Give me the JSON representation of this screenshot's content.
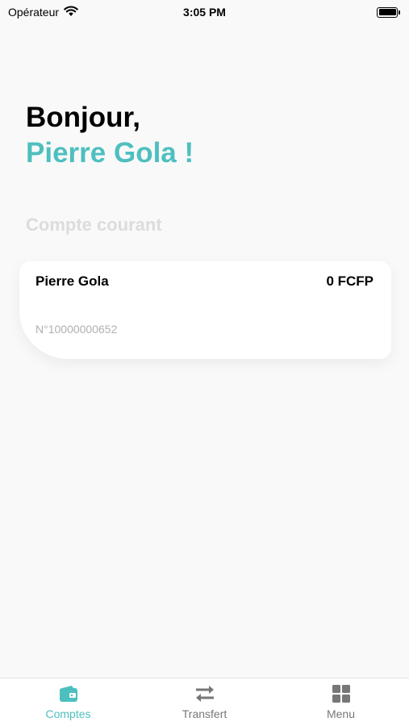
{
  "status_bar": {
    "carrier": "Opérateur",
    "time": "3:05 PM"
  },
  "greeting": {
    "line1": "Bonjour,",
    "name": "Pierre Gola !"
  },
  "section": {
    "title": "Compte courant"
  },
  "account": {
    "holder": "Pierre Gola",
    "balance": "0 FCFP",
    "number": "N°10000000652"
  },
  "tabs": [
    {
      "label": "Comptes",
      "icon": "wallet-icon",
      "active": true
    },
    {
      "label": "Transfert",
      "icon": "transfer-arrows-icon",
      "active": false
    },
    {
      "label": "Menu",
      "icon": "grid-menu-icon",
      "active": false
    }
  ],
  "colors": {
    "accent": "#4ebfbf",
    "section_title": "#dcdcdc",
    "inactive_tab": "#777777"
  }
}
